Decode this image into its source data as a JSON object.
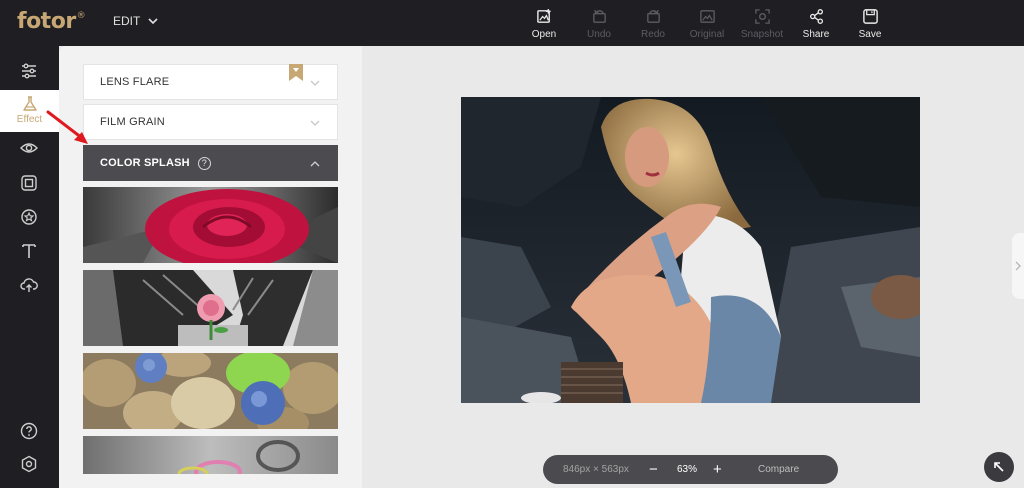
{
  "brand": {
    "logo_text": "fotor",
    "logo_mark": "®",
    "accent": "#c7a874"
  },
  "edit_menu": {
    "label": "EDIT"
  },
  "toolbar": [
    {
      "label": "Open",
      "enabled": true
    },
    {
      "label": "Undo",
      "enabled": false
    },
    {
      "label": "Redo",
      "enabled": false
    },
    {
      "label": "Original",
      "enabled": false
    },
    {
      "label": "Snapshot",
      "enabled": false
    },
    {
      "label": "Share",
      "enabled": true
    },
    {
      "label": "Save",
      "enabled": true
    }
  ],
  "rail": {
    "active_label": "Effect",
    "icons": [
      "adjust-sliders-icon",
      "effect-flask-icon",
      "eye-icon",
      "frame-icon",
      "sticker-star-icon",
      "text-icon",
      "cloud-upload-icon",
      "help-icon",
      "settings-icon"
    ]
  },
  "panel": {
    "sections": [
      {
        "label": "LENS FLARE",
        "open": false,
        "premium": true
      },
      {
        "label": "FILM GRAIN",
        "open": false,
        "premium": false
      },
      {
        "label": "COLOR SPLASH",
        "open": true,
        "help": "?"
      }
    ],
    "thumbnails": [
      "rose",
      "flower-in-hands",
      "potatoes-blueberries",
      "rings"
    ]
  },
  "zoom": {
    "dimensions": "846px × 563px",
    "minus": "−",
    "level": "63%",
    "plus": "+",
    "compare_label": "Compare"
  }
}
